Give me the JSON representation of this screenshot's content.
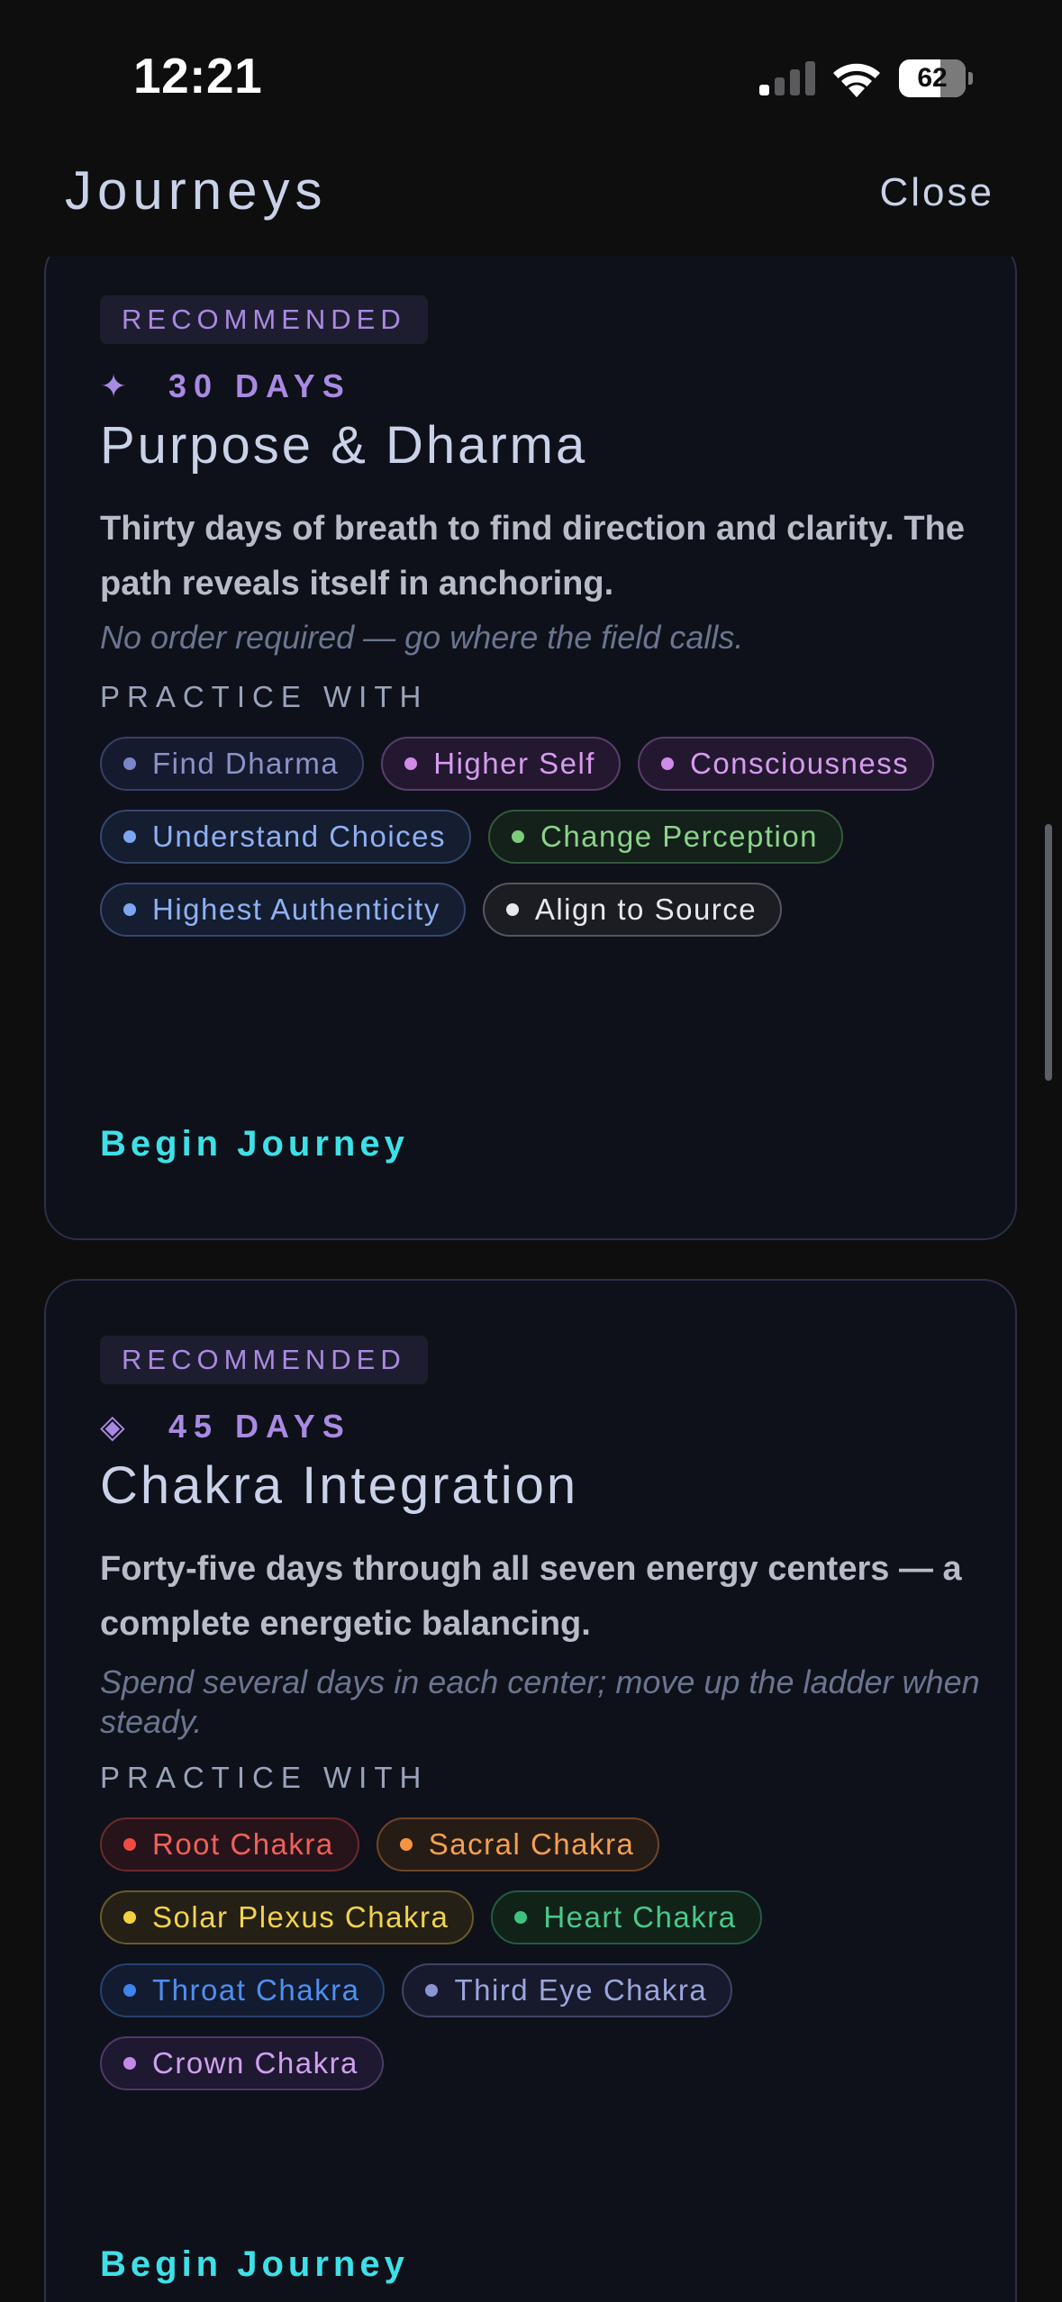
{
  "status_bar": {
    "time": "12:21",
    "battery_percent": "62",
    "battery_level": 0.62,
    "signal_bars_active": 1,
    "signal_bars_total": 4
  },
  "header": {
    "title": "Journeys",
    "close_label": "Close"
  },
  "journeys": [
    {
      "badge": "RECOMMENDED",
      "icon": "sparkle-icon",
      "icon_glyph": "✦",
      "duration": "30 DAYS",
      "title": "Purpose & Dharma",
      "description": "Thirty days of breath to find direction and clarity. The path reveals itself in anchoring.",
      "note": "No order required — go where the field calls.",
      "practice_label": "PRACTICE WITH",
      "practices": [
        {
          "label": "Find Dharma",
          "color": "#8a93c8",
          "dot": "#7b86c8",
          "border": "#3a3f66",
          "bg": "#161a2e"
        },
        {
          "label": "Higher Self",
          "color": "#d79aee",
          "dot": "#d08be8",
          "border": "#5a3d6c",
          "bg": "#231830"
        },
        {
          "label": "Consciousness",
          "color": "#d79aee",
          "dot": "#d08be8",
          "border": "#5a3d6c",
          "bg": "#231830"
        },
        {
          "label": "Understand Choices",
          "color": "#8fb0f2",
          "dot": "#7ea6f0",
          "border": "#35486e",
          "bg": "#151d30"
        },
        {
          "label": "Change Perception",
          "color": "#8ed28c",
          "dot": "#7fcb7c",
          "border": "#34583a",
          "bg": "#13211a"
        },
        {
          "label": "Highest Authenticity",
          "color": "#8fb0f2",
          "dot": "#7ea6f0",
          "border": "#35486e",
          "bg": "#151d30"
        },
        {
          "label": "Align to Source",
          "color": "#e8e8ec",
          "dot": "#e8e8ec",
          "border": "#55575e",
          "bg": "#1c1d22"
        }
      ],
      "begin_label": "Begin Journey"
    },
    {
      "badge": "RECOMMENDED",
      "icon": "diamond-icon",
      "icon_glyph": "◈",
      "duration": "45 DAYS",
      "title": "Chakra Integration",
      "description": "Forty-five days through all seven energy centers — a complete energetic balancing.",
      "note": "Spend several days in each center; move up the ladder when steady.",
      "practice_label": "PRACTICE WITH",
      "practices": [
        {
          "label": "Root Chakra",
          "color": "#f0605a",
          "dot": "#f04a44",
          "border": "#6a2a2e",
          "bg": "#26141a"
        },
        {
          "label": "Sacral Chakra",
          "color": "#f5a04e",
          "dot": "#f59440",
          "border": "#6c4528",
          "bg": "#261c16"
        },
        {
          "label": "Solar Plexus Chakra",
          "color": "#f3d34c",
          "dot": "#f3d040",
          "border": "#6a5a28",
          "bg": "#242016"
        },
        {
          "label": "Heart Chakra",
          "color": "#48c98a",
          "dot": "#3cc47e",
          "border": "#245a44",
          "bg": "#112219"
        },
        {
          "label": "Throat Chakra",
          "color": "#4e8ff0",
          "dot": "#3d84f0",
          "border": "#26426e",
          "bg": "#121b30"
        },
        {
          "label": "Third Eye Chakra",
          "color": "#9aa6dc",
          "dot": "#8a96d4",
          "border": "#3e4466",
          "bg": "#171a2c"
        },
        {
          "label": "Crown Chakra",
          "color": "#cfa0f0",
          "dot": "#c08ae8",
          "border": "#4c3a66",
          "bg": "#1e1830"
        }
      ],
      "begin_label": "Begin Journey"
    }
  ],
  "colors": {
    "background": "#0e0e0f",
    "card_bg": "#0e1119",
    "card_border": "#2e2e48",
    "accent_purple": "#a98ae2",
    "accent_cyan": "#3ee0e8",
    "title_text": "#c9d2e8"
  }
}
